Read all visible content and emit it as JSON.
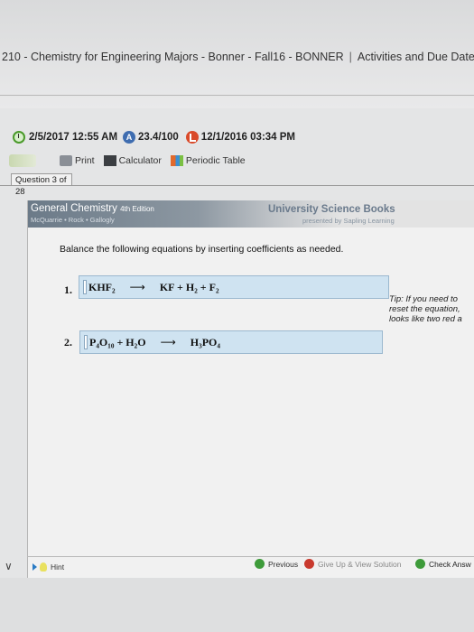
{
  "header": {
    "course_title": "210 - Chemistry for Engineering Majors - Bonner - Fall16 - BONNER",
    "separator": "|",
    "activities_label": "Activities and Due Dates",
    "separator2": "|"
  },
  "status": {
    "datetime": "2/5/2017 12:55 AM",
    "score": "23.4/100",
    "due": "12/1/2016 03:34 PM",
    "score_badge": "A"
  },
  "toolbar": {
    "print_label": "Print",
    "calculator_label": "Calculator",
    "periodic_label": "Periodic Table"
  },
  "question": {
    "tab_label": "Question 3 of 28"
  },
  "banner": {
    "book_title": "General Chemistry",
    "edition": "4th Edition",
    "authors": "McQuarrie • Rock • Gallogly",
    "publisher": "University Science Books",
    "publisher_sub": "presented by Sapling Learning"
  },
  "problem": {
    "instruction": "Balance the following equations by inserting coefficients as needed.",
    "equations": [
      {
        "num": "1.",
        "lhs": "KHF₂",
        "rhs": "KF + H₂ + F₂"
      },
      {
        "num": "2.",
        "lhs": "P₄O₁₀ + H₂O",
        "rhs": "H₃PO₄"
      }
    ],
    "arrow": "⟶",
    "tip_lines": [
      "Tip: If you need to",
      "reset the equation,",
      "looks like two red a"
    ]
  },
  "footer": {
    "hint_label": "Hint",
    "previous_label": "Previous",
    "giveup_label": "Give Up & View Solution",
    "check_label": "Check Answ"
  }
}
